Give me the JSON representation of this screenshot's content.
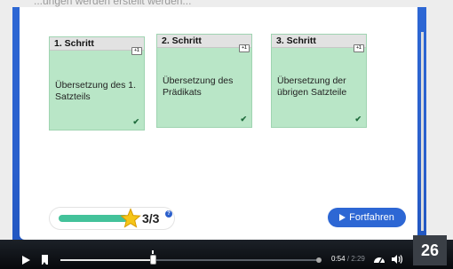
{
  "header": {
    "title_fragment": "...ungen werden erstellt werden..."
  },
  "cards": [
    {
      "step": "1. Schritt",
      "badge": "+1",
      "text": "Übersetzung des 1. Satzteils",
      "check": "✔"
    },
    {
      "step": "2. Schritt",
      "badge": "+1",
      "text": "Übersetzung des Prädikats",
      "check": "✔"
    },
    {
      "step": "3. Schritt",
      "badge": "+1",
      "text": "Übersetzung der übrigen Satzteile",
      "check": "✔"
    }
  ],
  "progress": {
    "text": "3/3",
    "fraction": 1.0,
    "help": "?"
  },
  "continue_button": {
    "label": "Fortfahren"
  },
  "player": {
    "current_time": "0:54",
    "duration": "2:29",
    "progress_fraction": 0.362,
    "page_number": "26"
  },
  "colors": {
    "stage_blue": "#2d67d4",
    "card_green": "#b9e6c7",
    "progress_green": "#43c29a",
    "star": "#f5c518"
  },
  "icons": [
    "star-icon",
    "help-icon",
    "play-icon",
    "bookmark-icon",
    "speed-icon",
    "volume-icon",
    "check-icon",
    "play-arrow-icon"
  ]
}
